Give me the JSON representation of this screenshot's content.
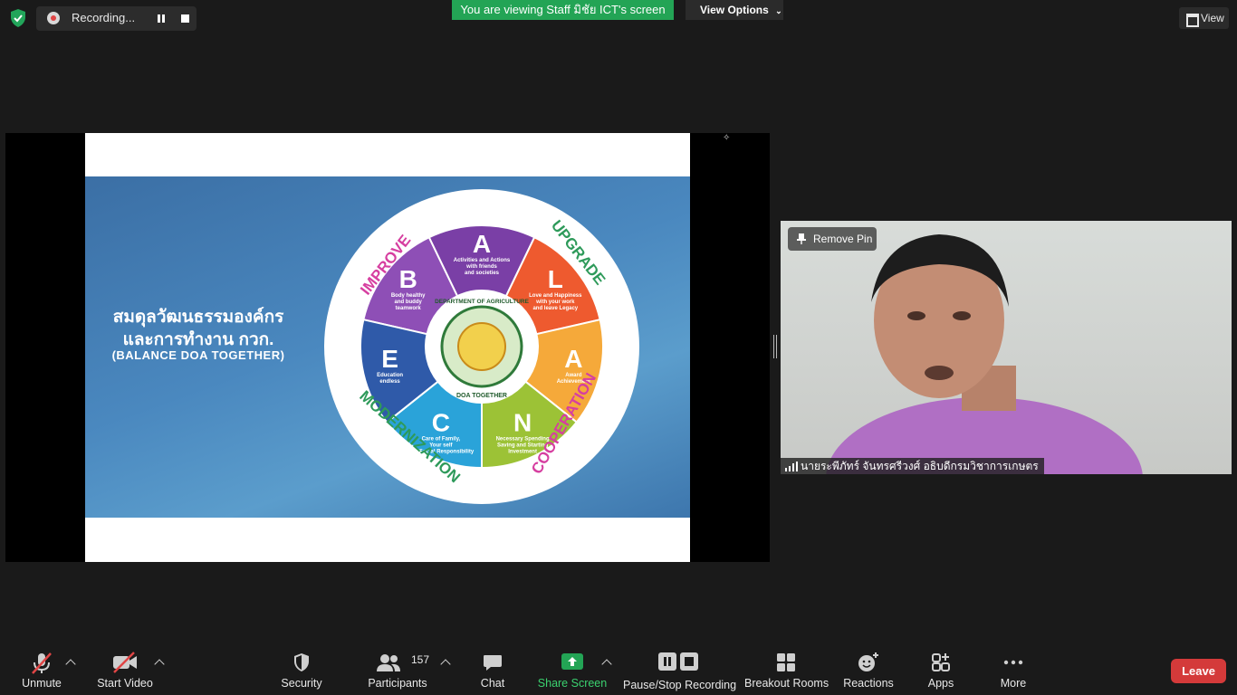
{
  "top_bar": {
    "recording_label": "Recording...",
    "viewing_banner": "You are viewing Staff มิชัย ICT's screen",
    "view_options_label": "View Options",
    "view_label": "View"
  },
  "slide": {
    "thai_line1": "สมดุลวัฒนธรรมองค์กร",
    "thai_line2": "และการทำงาน กวก.",
    "subtitle": "(BALANCE DOA TOGETHER)",
    "ring_labels": {
      "improve": "IMPROVE",
      "upgrade": "UPGRADE",
      "cooperation": "COOPERATION",
      "modernization": "MODERNIZATION"
    },
    "segments": [
      {
        "letter": "B",
        "text1": "Body healthy",
        "text2": "and buddy",
        "text3": "teamwork",
        "color": "#8e4fb6"
      },
      {
        "letter": "A",
        "text1": "Activities and Actions",
        "text2": "with friends",
        "text3": "and societies",
        "color": "#7a3fa6"
      },
      {
        "letter": "L",
        "text1": "Love and Happiness",
        "text2": "with your work",
        "text3": "and leave Legacy",
        "color": "#ee5a2f"
      },
      {
        "letter": "A",
        "text1": "Award",
        "text2": "Achievement",
        "text3": "",
        "color": "#f5a93a"
      },
      {
        "letter": "N",
        "text1": "Necessary Spending",
        "text2": "Saving and Starting",
        "text3": "Investment",
        "color": "#9cc236"
      },
      {
        "letter": "C",
        "text1": "Care of Family,",
        "text2": "Your self",
        "text3": "and Social Responsibility",
        "color": "#2aa3d9"
      },
      {
        "letter": "E",
        "text1": "Education",
        "text2": "endless",
        "text3": "",
        "color": "#2f5aa9"
      }
    ],
    "center_top": "DEPARTMENT OF AGRICULTURE",
    "center_bottom": "DOA TOGETHER"
  },
  "participant": {
    "remove_pin_label": "Remove Pin",
    "name": "นายระพีภัทร์ จันทรศรีวงศ์ อธิบดีกรมวิชาการเกษตร"
  },
  "toolbar": {
    "unmute": "Unmute",
    "start_video": "Start Video",
    "security": "Security",
    "participants": "Participants",
    "participants_count": "157",
    "chat": "Chat",
    "share_screen": "Share Screen",
    "pause_stop_recording": "Pause/Stop Recording",
    "breakout_rooms": "Breakout Rooms",
    "reactions": "Reactions",
    "apps": "Apps",
    "more": "More",
    "leave": "Leave"
  },
  "colors": {
    "share_green": "#23a455",
    "leave_red": "#d43a3a",
    "background": "#1a1a1a"
  }
}
